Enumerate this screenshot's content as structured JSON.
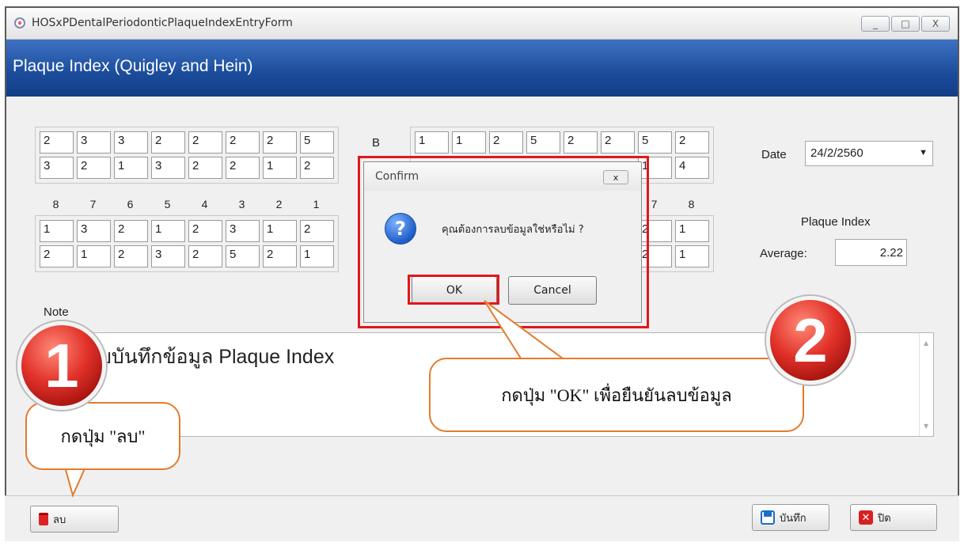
{
  "window": {
    "title": "HOSxPDentalPeriodonticPlaqueIndexEntryForm",
    "controls": [
      "_",
      "□",
      "X"
    ]
  },
  "header": {
    "title": "Plaque Index (Quigley and Hein)"
  },
  "chart": {
    "upper_left": [
      [
        "2",
        "3",
        "3",
        "2",
        "2",
        "2",
        "2",
        "5"
      ],
      [
        "3",
        "2",
        "1",
        "3",
        "2",
        "2",
        "1",
        "2"
      ]
    ],
    "upper_right": [
      [
        "1",
        "1",
        "2",
        "5",
        "2",
        "2",
        "5",
        "2"
      ],
      [
        "",
        "",
        "",
        "",
        "",
        "",
        "1",
        "4"
      ]
    ],
    "lower_left": [
      [
        "1",
        "3",
        "2",
        "1",
        "2",
        "3",
        "1",
        "2"
      ],
      [
        "2",
        "1",
        "2",
        "3",
        "2",
        "5",
        "2",
        "1"
      ]
    ],
    "lower_right": [
      [
        "",
        "",
        "",
        "",
        "",
        "",
        "2",
        "1"
      ],
      [
        "",
        "",
        "",
        "",
        "",
        "",
        "2",
        "1"
      ]
    ],
    "tooth_numbers_left": [
      "8",
      "7",
      "6",
      "5",
      "4",
      "3",
      "2",
      "1"
    ],
    "tooth_numbers_right": [
      "7",
      "8"
    ],
    "section_label": "B"
  },
  "date": {
    "label": "Date",
    "value": "24/2/2560"
  },
  "plaque": {
    "title": "Plaque Index",
    "avg_label": "Average:",
    "avg_value": "2.22"
  },
  "note": {
    "label": "Note",
    "text": "บบันทึกข้อมูล Plaque Index"
  },
  "footer": {
    "delete_label": "ลบ",
    "save_label": "บันทึก",
    "close_label": "ปิด"
  },
  "dialog": {
    "title": "Confirm",
    "close": "x",
    "message": "คุณต้องการลบข้อมูลใช่หรือไม่ ?",
    "ok": "OK",
    "cancel": "Cancel"
  },
  "callouts": {
    "step1_number": "1",
    "step1_text": "กดปุ่ม \"ลบ\"",
    "step2_number": "2",
    "step2_text": "กดปุ่ม \"OK\" เพื่อยืนยันลบข้อมูล"
  },
  "colors": {
    "header": "#1b4c9b",
    "highlight": "#e3161b",
    "callout": "#e47b2c"
  }
}
